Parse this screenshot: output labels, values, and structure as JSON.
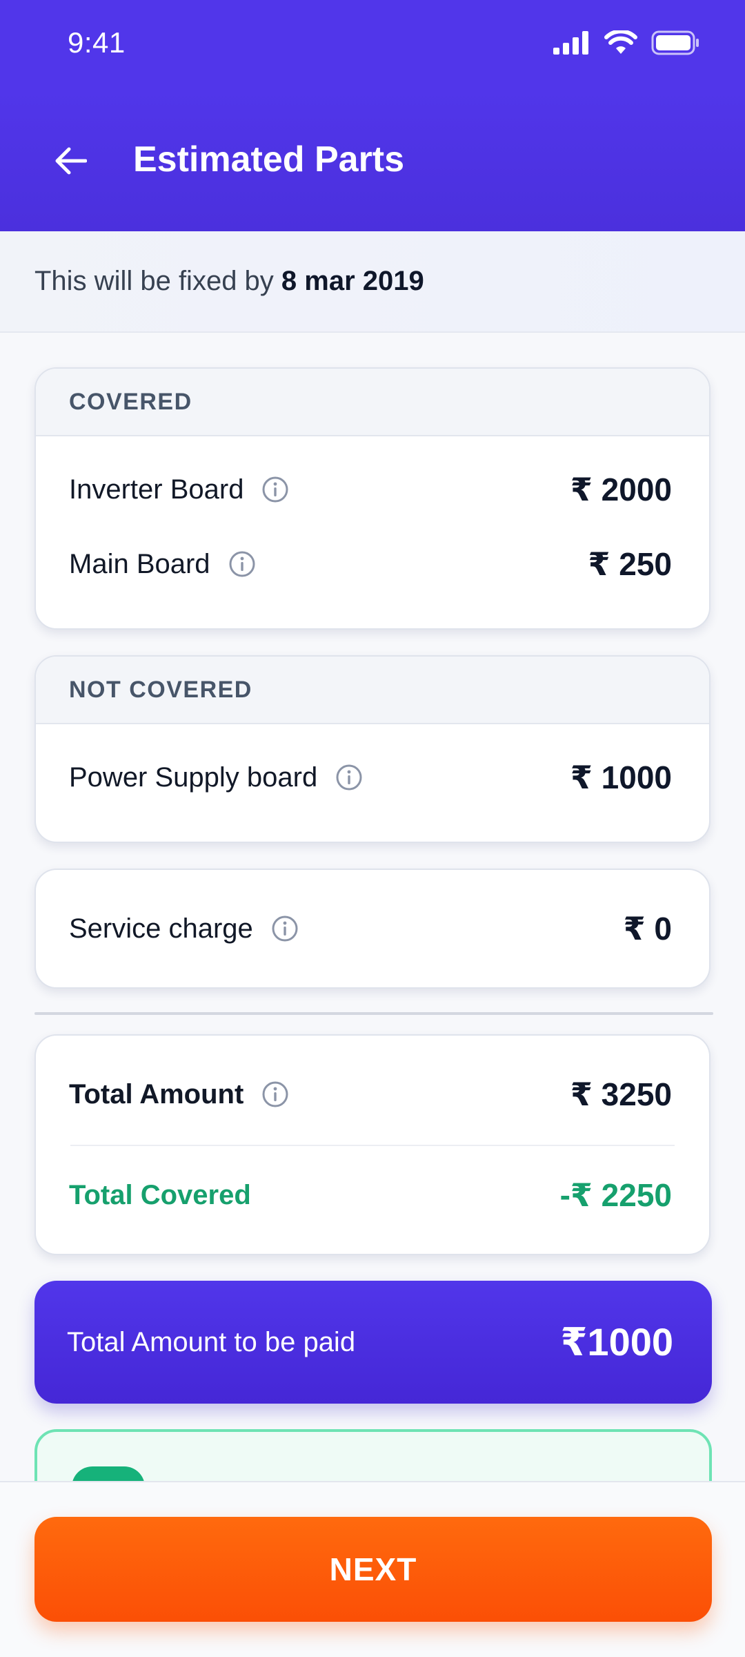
{
  "status_bar": {
    "time": "9:41"
  },
  "header": {
    "title": "Estimated Parts"
  },
  "fix_banner": {
    "prefix": "This will be fixed by",
    "date": "8 mar 2019"
  },
  "covered": {
    "heading": "COVERED",
    "items": [
      {
        "label": "Inverter Board",
        "amount": "₹ 2000"
      },
      {
        "label": "Main Board",
        "amount": "₹ 250"
      }
    ]
  },
  "not_covered": {
    "heading": "NOT COVERED",
    "items": [
      {
        "label": "Power Supply board",
        "amount": "₹ 1000"
      }
    ]
  },
  "service": {
    "label": "Service charge",
    "amount": "₹ 0"
  },
  "totals": {
    "total_label": "Total Amount",
    "total_amount": "₹ 3250",
    "covered_label": "Total Covered",
    "covered_amount": "-₹ 2250"
  },
  "payable": {
    "label": "Total Amount to be paid",
    "amount": "₹1000"
  },
  "footer": {
    "next_label": "NEXT"
  },
  "colors": {
    "primary": "#5136ea",
    "accent_orange": "#fb5a0a",
    "covered_green": "#16a06d",
    "peek_border": "#6ee3b4"
  },
  "icons": {
    "back": "arrow-left-icon",
    "info": "info-circle-icon",
    "signal": "signal-icon",
    "wifi": "wifi-icon",
    "battery": "battery-icon"
  }
}
